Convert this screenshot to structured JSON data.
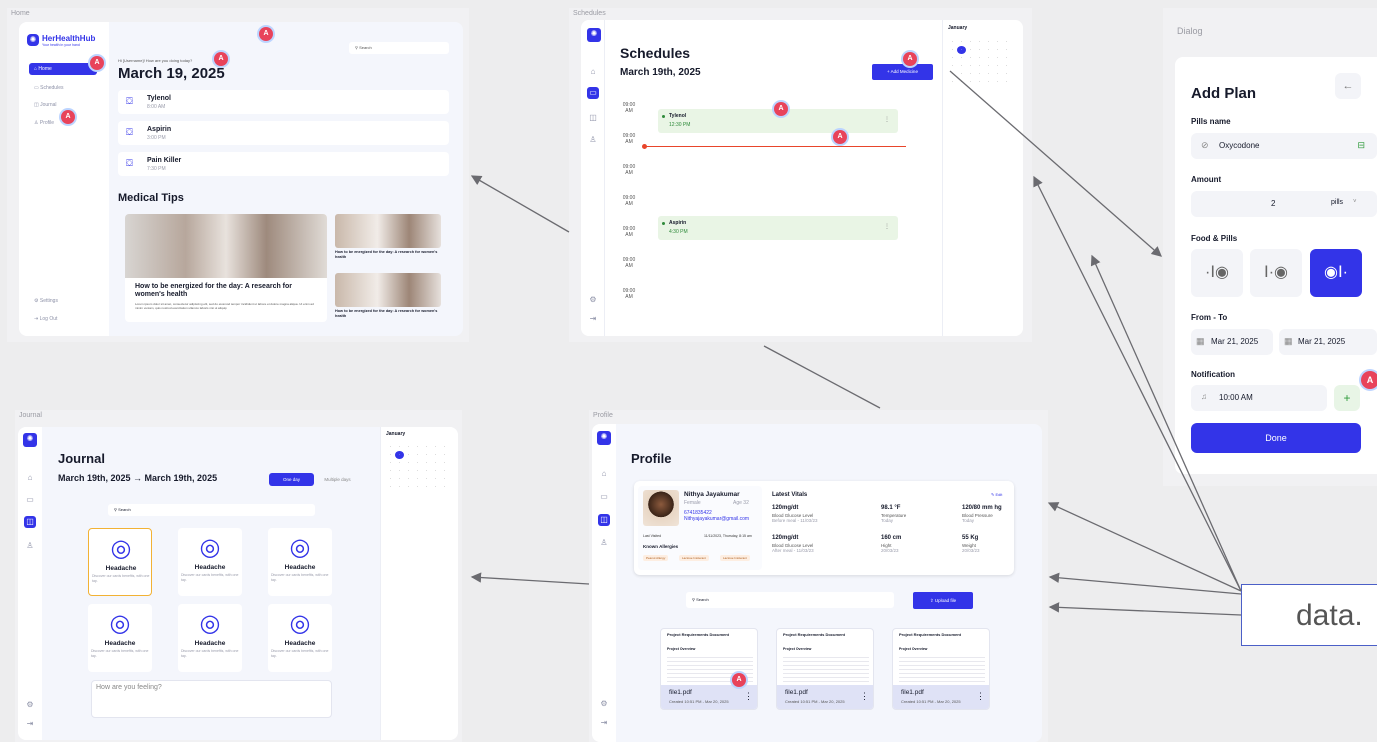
{
  "home": {
    "frame_label": "Home",
    "app_name": "HerHealthHub",
    "app_tagline": "Your health in your hand",
    "greeting": "Hi [Username]! How are you doing today?",
    "date": "March 19, 2025",
    "search_placeholder": "Search",
    "nav": [
      {
        "label": "Home",
        "icon": "home-icon"
      },
      {
        "label": "Schedules",
        "icon": "calendar-icon"
      },
      {
        "label": "Journal",
        "icon": "journal-icon"
      },
      {
        "label": "Profile",
        "icon": "user-icon"
      }
    ],
    "nav_bottom": [
      {
        "label": "Settings",
        "icon": "gear-icon"
      },
      {
        "label": "Log Out",
        "icon": "logout-icon"
      }
    ],
    "meds": [
      {
        "name": "Tylenol",
        "time": "8:00 AM"
      },
      {
        "name": "Aspirin",
        "time": "3:00 PM"
      },
      {
        "name": "Pain Killer",
        "time": "7:30 PM"
      }
    ],
    "tips_title": "Medical Tips",
    "tip_main_title": "How to be energized for the day: A research for women's health",
    "tip_main_body": "Lorem ipsum dolor sit amet, consectetur adipiscing elit, sed do eiusmod tempor incididunt ut labore et dolore magna aliqua. Ut enim ad minim veniam, quis nostrud exercitation ullamco laboris nisi ut aliquip",
    "tip_side_title": "How to be energized for the day: A research for women's health"
  },
  "schedules": {
    "frame_label": "Schedules",
    "title": "Schedules",
    "date": "March 19th, 2025",
    "add_button": "+ Add Medicine",
    "hours": [
      "09:00 AM",
      "09:00 AM",
      "09:00 AM",
      "09:00 AM",
      "09:00 AM",
      "09:00 AM",
      "09:00 AM"
    ],
    "events": [
      {
        "name": "Tylenol",
        "time": "12:30 PM"
      },
      {
        "name": "Aspirin",
        "time": "4:30 PM"
      }
    ],
    "calendar_month": "January"
  },
  "dialog": {
    "frame_label": "Dialog",
    "title": "Add Plan",
    "pills_label": "Pills name",
    "pills_value": "Oxycodone",
    "amount_label": "Amount",
    "amount_value": "2",
    "amount_unit": "pills",
    "food_label": "Food & Pills",
    "fromto_label": "From - To",
    "from_date": "Mar 21, 2025",
    "to_date": "Mar 21, 2025",
    "notif_label": "Notification",
    "notif_time": "10:00 AM",
    "done_button": "Done"
  },
  "journal": {
    "frame_label": "Journal",
    "title": "Journal",
    "date_range": "March 19th, 2025 → March 19th, 2025",
    "toggle_one": "One day",
    "toggle_multi": "Multiple days",
    "search_placeholder": "Search",
    "card_title": "Headache",
    "card_body": "Discover our cards benefits, with one tap.",
    "feeling_placeholder": "How are you feeling?",
    "calendar_month": "January"
  },
  "profile": {
    "frame_label": "Profile",
    "title": "Profile",
    "name": "Nithya Jayakumar",
    "gender": "Female",
    "age": "Age 32",
    "phone": "6741835422",
    "email": "Nithyajayakumar@gmail.com",
    "last_visited_label": "Last Visited",
    "last_visited_value": "11/11/2023, Thursday, 8:15 am",
    "allergies_label": "Known Allergies",
    "allergies": [
      "Peanut Allergy",
      "Lactose Intolerant",
      "Lactose Intolerant"
    ],
    "vitals_title": "Latest Vitals",
    "edit_label": "Edit",
    "vitals": [
      {
        "value": "120mg/dt",
        "label": "Blood Glucose Level",
        "note": "Before meal - 11/03/23"
      },
      {
        "value": "98.1 °F",
        "label": "Temperature",
        "note": "Today"
      },
      {
        "value": "120/80 mm hg",
        "label": "Blood Pressure",
        "note": "Today"
      },
      {
        "value": "120mg/dt",
        "label": "Blood Glucose Level",
        "note": "After meal - 11/03/23"
      },
      {
        "value": "160 cm",
        "label": "Hight",
        "note": "20/03/23"
      },
      {
        "value": "55 Kg",
        "label": "Weight",
        "note": "20/03/23"
      }
    ],
    "search_placeholder": "Search",
    "upload_button": "Upload file",
    "doc_title": "Project Requirements Document",
    "doc_section": "Project Overview",
    "files": [
      {
        "name": "file1.pdf",
        "meta": "Created 10:51 PM - Mar 20, 2025"
      },
      {
        "name": "file1.pdf",
        "meta": "Created 10:51 PM - Mar 20, 2025"
      },
      {
        "name": "file1.pdf",
        "meta": "Created 10:51 PM - Mar 20, 2025"
      }
    ]
  },
  "data_label": "data.",
  "badge_letter": "A",
  "colors": {
    "accent": "#3334e8",
    "badge": "#e8435b",
    "arrow": "#6b6b70",
    "data_box": "#4b5fc7"
  }
}
